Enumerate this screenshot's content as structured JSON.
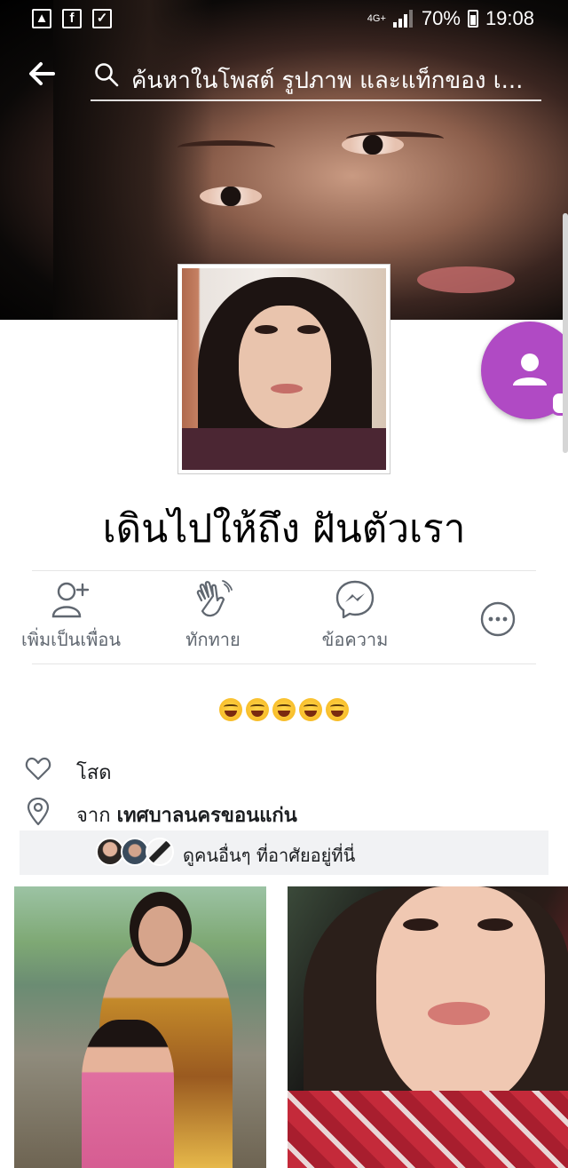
{
  "status_bar": {
    "network": "4G+",
    "battery": "70%",
    "time": "19:08"
  },
  "search": {
    "placeholder": "ค้นหาในโพสต์ รูปภาพ และแท็กของ เ..."
  },
  "profile": {
    "name": "เดินไปให้ถึง ฝันตัวเรา"
  },
  "actions": [
    {
      "label": "เพิ่มเป็นเพื่อน",
      "icon": "add-friend-icon"
    },
    {
      "label": "ทักทาย",
      "icon": "wave-icon"
    },
    {
      "label": "ข้อความ",
      "icon": "messenger-icon"
    },
    {
      "label": "",
      "icon": "more-icon"
    }
  ],
  "bio": {
    "emoji_count": 5,
    "emoji": "laughing-face"
  },
  "info": {
    "relationship": "โสด",
    "from_prefix": "จาก",
    "from_place": "เทศบาลนครขอนแก่น",
    "friends_here": "ดูคนอื่นๆ ที่อาศัยอยู่ที่นี่"
  },
  "colors": {
    "fab": "#b04ac4",
    "icon_gray": "#606770",
    "friends_bar_bg": "#f1f2f4"
  }
}
